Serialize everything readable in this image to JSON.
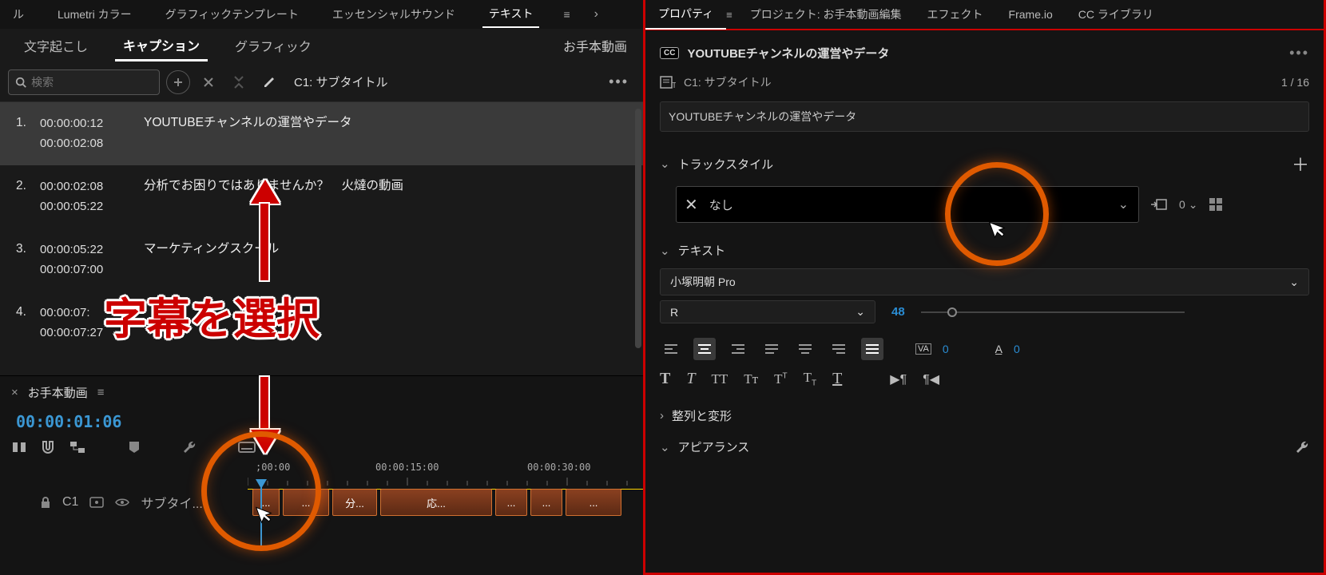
{
  "left": {
    "topTabs": [
      "ル",
      "Lumetri カラー",
      "グラフィックテンプレート",
      "エッセンシャルサウンド",
      "テキスト"
    ],
    "topTabsActiveIndex": 4,
    "subTabs": [
      "文字起こし",
      "キャプション",
      "グラフィック"
    ],
    "subTabsActiveIndex": 1,
    "subTabsRight": "お手本動画",
    "searchPlaceholder": "検索",
    "captionTrackLabel": "C1: サブタイトル",
    "captions": [
      {
        "n": "1.",
        "start": "00:00:00:12",
        "end": "00:00:02:08",
        "text": "YOUTUBEチャンネルの運営やデータ"
      },
      {
        "n": "2.",
        "start": "00:00:02:08",
        "end": "00:00:05:22",
        "text": "分析でお困りではありませんか？　火燵の動画"
      },
      {
        "n": "3.",
        "start": "00:00:05:22",
        "end": "00:00:07:00",
        "text": "マーケティングスクール"
      },
      {
        "n": "4.",
        "start": "00:00:07:",
        "end": "00:00:07:27",
        "text": ""
      }
    ],
    "timeline": {
      "sequenceName": "お手本動画",
      "timecode": "00:00:01:06",
      "marks": [
        ";00:00",
        "00:00:15:00",
        "00:00:30:00"
      ],
      "trackHead": {
        "lockLabel": "C1",
        "name": "サブタイ..."
      },
      "clips": [
        "...",
        "...",
        "分...",
        "応...",
        "...",
        "...",
        "..."
      ]
    }
  },
  "right": {
    "tabs": [
      "プロパティ",
      "プロジェクト: お手本動画編集",
      "エフェクト",
      "Frame.io",
      "CC ライブラリ"
    ],
    "tabsActiveIndex": 0,
    "ccTitle": "YOUTUBEチャンネルの運営やデータ",
    "trackLabel": "C1: サブタイトル",
    "counter": "1 / 16",
    "textInput": "YOUTUBEチャンネルの運営やデータ",
    "sections": {
      "trackStyle": "トラックスタイル",
      "textSection": "テキスト",
      "alignSection": "整列と変形",
      "appearanceSection": "アピアランス"
    },
    "styleNone": "なし",
    "styleZero": "0",
    "fontName": "小塚明朝 Pro",
    "fontWeight": "R",
    "fontSize": "48",
    "vaLabel": "VA",
    "vaValue": "0",
    "kernValue": "0"
  },
  "annotations": {
    "selectCaption": "字幕を選択"
  }
}
